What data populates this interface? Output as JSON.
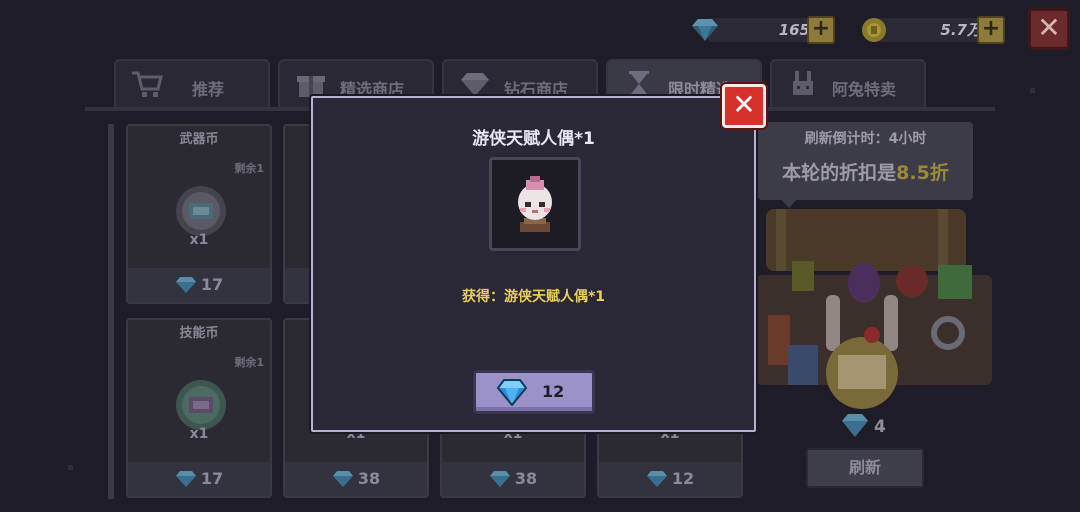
{
  "currency": {
    "gems": "165",
    "coins": "5.7万",
    "plus": "+"
  },
  "close_glyph": "✕",
  "tabs": [
    {
      "label": "推荐",
      "icon": "cart-icon"
    },
    {
      "label": "精选商店",
      "icon": "gift-icon"
    },
    {
      "label": "钻石商店",
      "icon": "diamond-icon"
    },
    {
      "label": "限时精选",
      "icon": "hourglass-icon"
    },
    {
      "label": "阿兔特卖",
      "icon": "bunny-icon"
    }
  ],
  "cards": [
    {
      "title": "武器币",
      "remain": "剩余1",
      "qty": "x1",
      "price": "17"
    },
    {
      "title": "技能币",
      "remain": "剩余1",
      "qty": "x1",
      "price": "17"
    },
    {
      "qty": "x1",
      "price": "38"
    },
    {
      "qty": "x1",
      "price": "38"
    },
    {
      "qty": "x1",
      "price": "12"
    }
  ],
  "promo": {
    "countdown": "刷新倒计时：4小时",
    "discount_prefix": "本轮的折扣是",
    "discount_value": "8.5折",
    "price": "4",
    "refresh_label": "刷新"
  },
  "modal": {
    "title": "游侠天赋人偶*1",
    "gain_text": "获得：游侠天赋人偶*1",
    "price": "12"
  },
  "colors": {
    "gem": "#4fb3f0",
    "accent_gold": "#e9cf5a",
    "close_red": "#d7312c",
    "buy_button": "#9a92c8"
  }
}
